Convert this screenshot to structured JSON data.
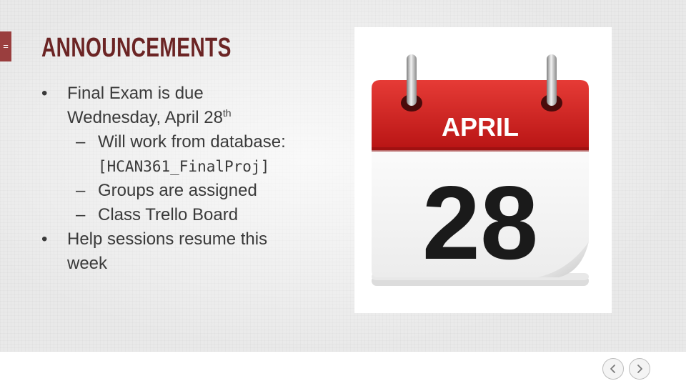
{
  "menu": {
    "icon": "hamburger-icon",
    "glyph": "="
  },
  "slide": {
    "title": "ANNOUNCEMENTS",
    "bullets": {
      "b1": {
        "marker": "•",
        "line1": "Final Exam is due",
        "line2": "Wednesday, April 28",
        "line2_sup": "th"
      },
      "sub1": {
        "marker": "–",
        "line1": "Will work from database:",
        "code": "[HCAN361_FinalProj]"
      },
      "sub2": {
        "marker": "–",
        "text": "Groups are assigned"
      },
      "sub3": {
        "marker": "–",
        "text": "Class Trello Board"
      },
      "b2": {
        "marker": "•",
        "line1": "Help sessions resume this",
        "line2": "week"
      }
    }
  },
  "calendar": {
    "month": "APRIL",
    "day": "28",
    "accent_color": "#d42a2a"
  },
  "navigation": {
    "prev_icon": "chevron-left-icon",
    "next_icon": "chevron-right-icon"
  }
}
